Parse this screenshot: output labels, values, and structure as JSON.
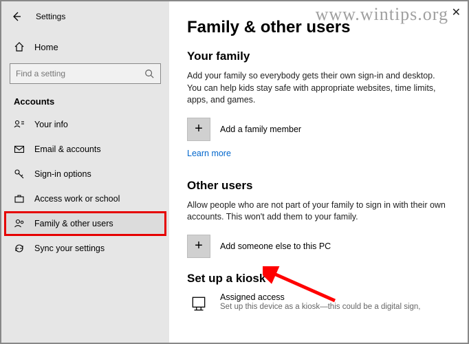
{
  "window": {
    "settings_label": "Settings",
    "close_glyph": "✕"
  },
  "sidebar": {
    "home_label": "Home",
    "search_placeholder": "Find a setting",
    "category_label": "Accounts",
    "items": [
      {
        "label": "Your info"
      },
      {
        "label": "Email & accounts"
      },
      {
        "label": "Sign-in options"
      },
      {
        "label": "Access work or school"
      },
      {
        "label": "Family & other users"
      },
      {
        "label": "Sync your settings"
      }
    ]
  },
  "main": {
    "title": "Family & other users",
    "family": {
      "heading": "Your family",
      "desc": "Add your family so everybody gets their own sign-in and desktop. You can help kids stay safe with appropriate websites, time limits, apps, and games.",
      "add_label": "Add a family member",
      "learn_more": "Learn more"
    },
    "other": {
      "heading": "Other users",
      "desc": "Allow people who are not part of your family to sign in with their own accounts. This won't add them to your family.",
      "add_label": "Add someone else to this PC"
    },
    "kiosk": {
      "heading": "Set up a kiosk",
      "name": "Assigned access",
      "sub": "Set up this device as a kiosk—this could be a digital sign,"
    }
  },
  "watermark": "www.wintips.org",
  "annotations": {
    "highlight_color": "#e60000",
    "arrow_color": "#ff0000"
  }
}
